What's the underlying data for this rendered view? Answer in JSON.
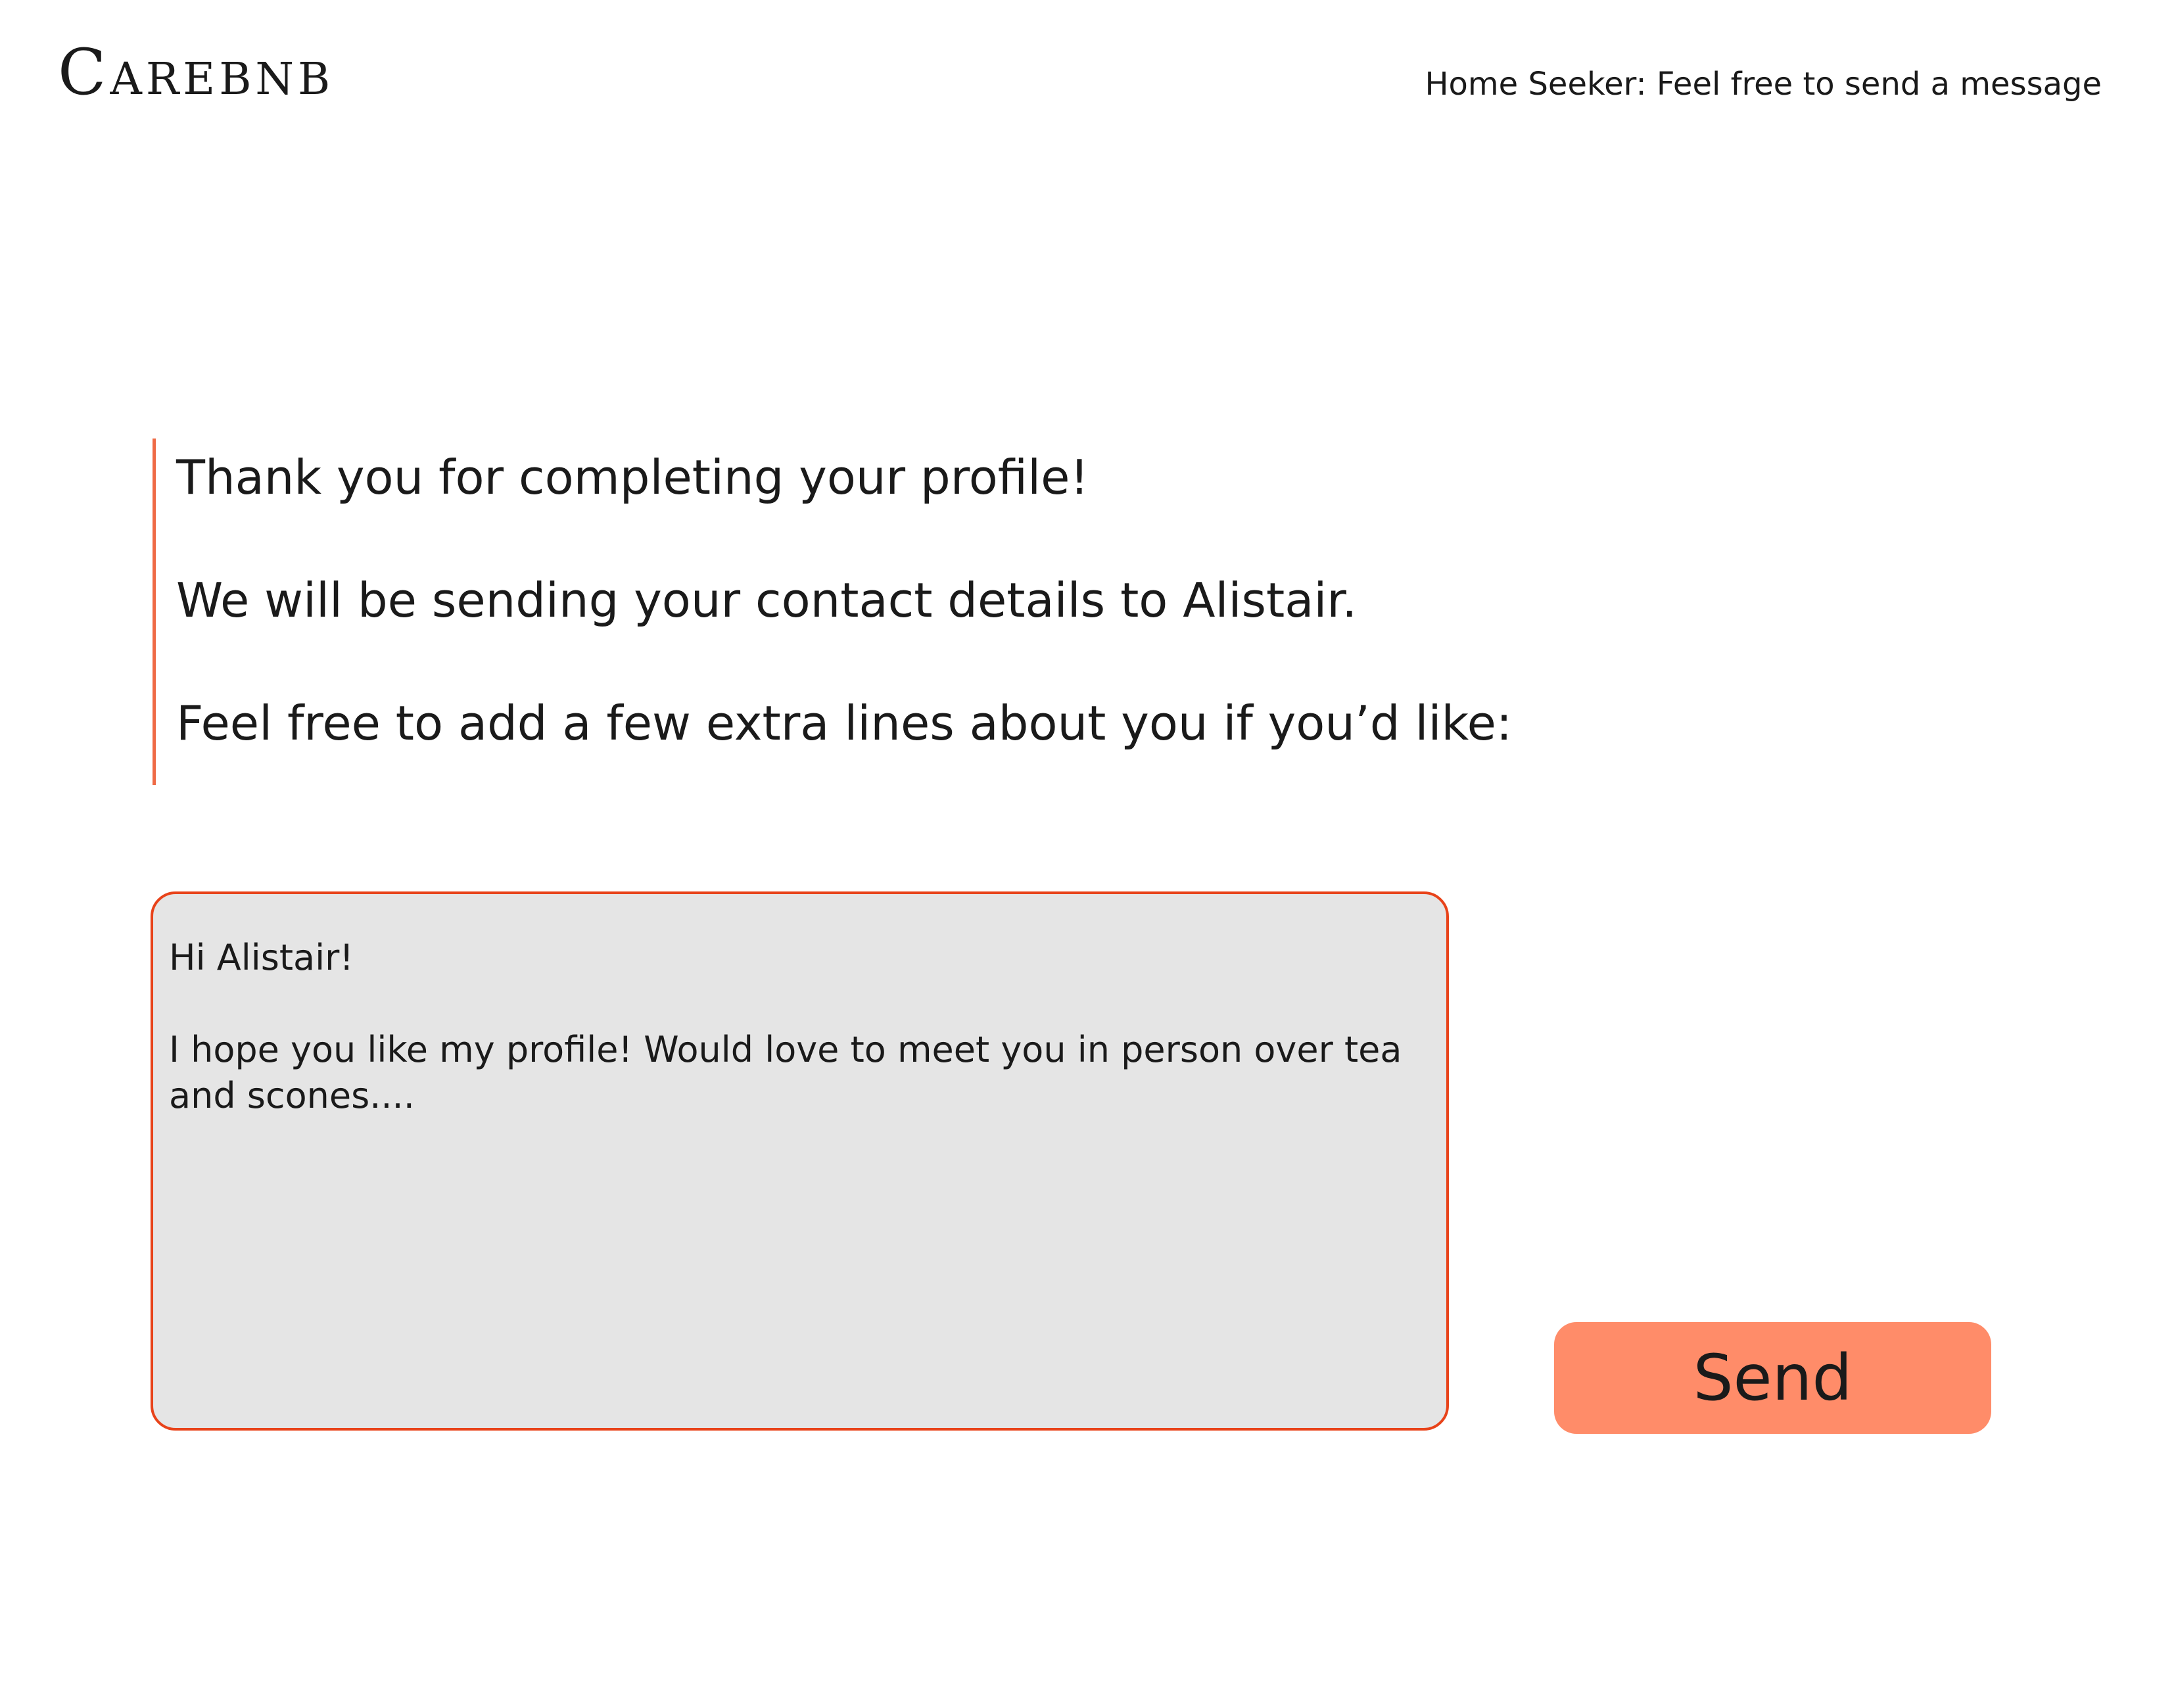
{
  "header": {
    "logo_text": "Carebnb",
    "subtitle": "Home Seeker: Feel free to send a message"
  },
  "intro": {
    "line1": "Thank you for completing your profile!",
    "line2": "We will be sending your contact details to Alistair.",
    "line3": "Feel free to add a few extra lines about you if you’d like:"
  },
  "message": {
    "value": "Hi Alistair!\n\nI hope you like my profile! Would love to meet you in person over tea and scones...."
  },
  "actions": {
    "send_label": "Send"
  },
  "colors": {
    "accent": "#e8431a",
    "button": "#ff8c69",
    "textarea_bg": "#e5e5e5"
  }
}
